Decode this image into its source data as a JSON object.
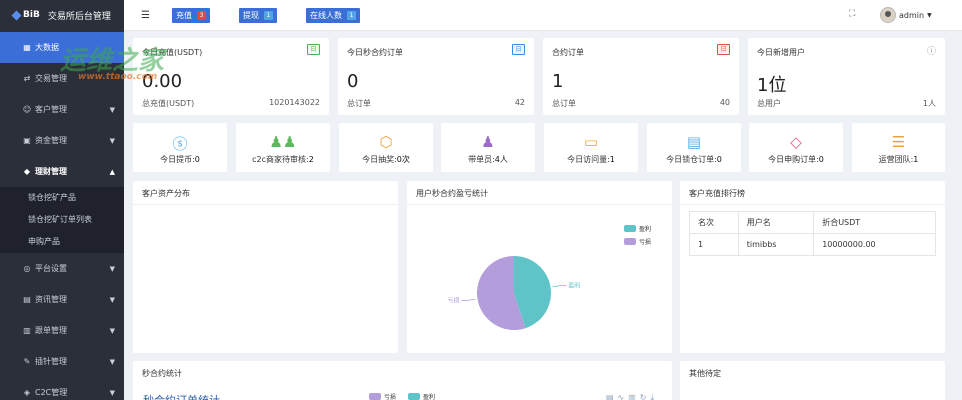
{
  "brand": {
    "logo_text": "BiB",
    "title": "交易所后台管理"
  },
  "sidebar": {
    "items": [
      {
        "label": "大数据",
        "icon": "dashboard-icon",
        "glyph": "▦"
      },
      {
        "label": "交易管理",
        "icon": "exchange-icon",
        "glyph": "⇄"
      },
      {
        "label": "客户管理",
        "icon": "user-icon",
        "glyph": "☺"
      },
      {
        "label": "资金管理",
        "icon": "wallet-icon",
        "glyph": "▣"
      },
      {
        "label": "理财管理",
        "icon": "finance-icon",
        "glyph": "◆"
      },
      {
        "label": "平台设置",
        "icon": "settings-icon",
        "glyph": "◎"
      },
      {
        "label": "资讯管理",
        "icon": "news-icon",
        "glyph": "▤"
      },
      {
        "label": "跟单管理",
        "icon": "copy-order-icon",
        "glyph": "▥"
      },
      {
        "label": "插针管理",
        "icon": "needle-icon",
        "glyph": "✎"
      },
      {
        "label": "C2C管理",
        "icon": "c2c-icon",
        "glyph": "◈"
      }
    ],
    "sub_items": [
      "锁仓挖矿产品",
      "锁仓挖矿订单列表",
      "申购产品"
    ]
  },
  "topbar": {
    "recharge_label": "充值",
    "recharge_count": "3",
    "withdraw_label": "提现",
    "withdraw_count": "1",
    "online_label": "在线人数",
    "online_count": "1",
    "username": "admin"
  },
  "stats": [
    {
      "title": "今日充值(USDT)",
      "tag": "日",
      "value": "0.00",
      "foot_label": "总充值(USDT)",
      "foot_value": "1020143022"
    },
    {
      "title": "今日秒合约订单",
      "tag": "日",
      "value": "0",
      "foot_label": "总订单",
      "foot_value": "42"
    },
    {
      "title": "合约订单",
      "tag": "日",
      "value": "1",
      "foot_label": "总订单",
      "foot_value": "40"
    },
    {
      "title": "今日新增用户",
      "tag": "",
      "value": "1位",
      "foot_label": "总用户",
      "foot_value": "1人"
    }
  ],
  "minis": [
    {
      "label": "今日提币:",
      "value": "0",
      "icon": "dollar-icon",
      "glyph": "$",
      "color": "#4aa8e8"
    },
    {
      "label": "c2c商家待审核:",
      "value": "2",
      "icon": "users-icon",
      "glyph": "👥",
      "color": "#5cb85c"
    },
    {
      "label": "今日抽奖:",
      "value": "0次",
      "icon": "box-icon",
      "glyph": "⬡",
      "color": "#f0a040"
    },
    {
      "label": "带单员:",
      "value": "4人",
      "icon": "person-icon",
      "glyph": "👤",
      "color": "#9a6cc8"
    },
    {
      "label": "今日访问量:",
      "value": "1",
      "icon": "browser-icon",
      "glyph": "▭",
      "color": "#f0b030"
    },
    {
      "label": "今日锁仓订单:",
      "value": "0",
      "icon": "document-icon",
      "glyph": "▤",
      "color": "#60b0e0"
    },
    {
      "label": "今日申购订单:",
      "value": "0",
      "icon": "tag-icon",
      "glyph": "◇",
      "color": "#e06080"
    },
    {
      "label": "运营团队:",
      "value": "1",
      "icon": "sliders-icon",
      "glyph": "☰",
      "color": "#f0a040"
    }
  ],
  "panels": {
    "asset_dist_title": "客户资产分布",
    "pie_title": "用户秒合约盈亏统计",
    "ranking_title": "客户充值排行榜",
    "second_contract_title": "秒合约统计",
    "second_contract_chart_title": "秒合约订单统计",
    "other_pending_title": "其他待定"
  },
  "ranking": {
    "headers": [
      "名次",
      "用户名",
      "折合USDT"
    ],
    "rows": [
      [
        "1",
        "timibbs",
        "10000000.00"
      ]
    ]
  },
  "chart_data": {
    "type": "pie",
    "title": "用户秒合约盈亏统计",
    "categories": [
      "盈利",
      "亏损"
    ],
    "values": [
      45,
      55
    ],
    "colors": [
      "#5fc4c8",
      "#b39ddb"
    ]
  },
  "bottom_legend": [
    "亏损",
    "盈利"
  ],
  "watermark": {
    "text": "运维之家",
    "url": "www.ttaoo.com"
  }
}
